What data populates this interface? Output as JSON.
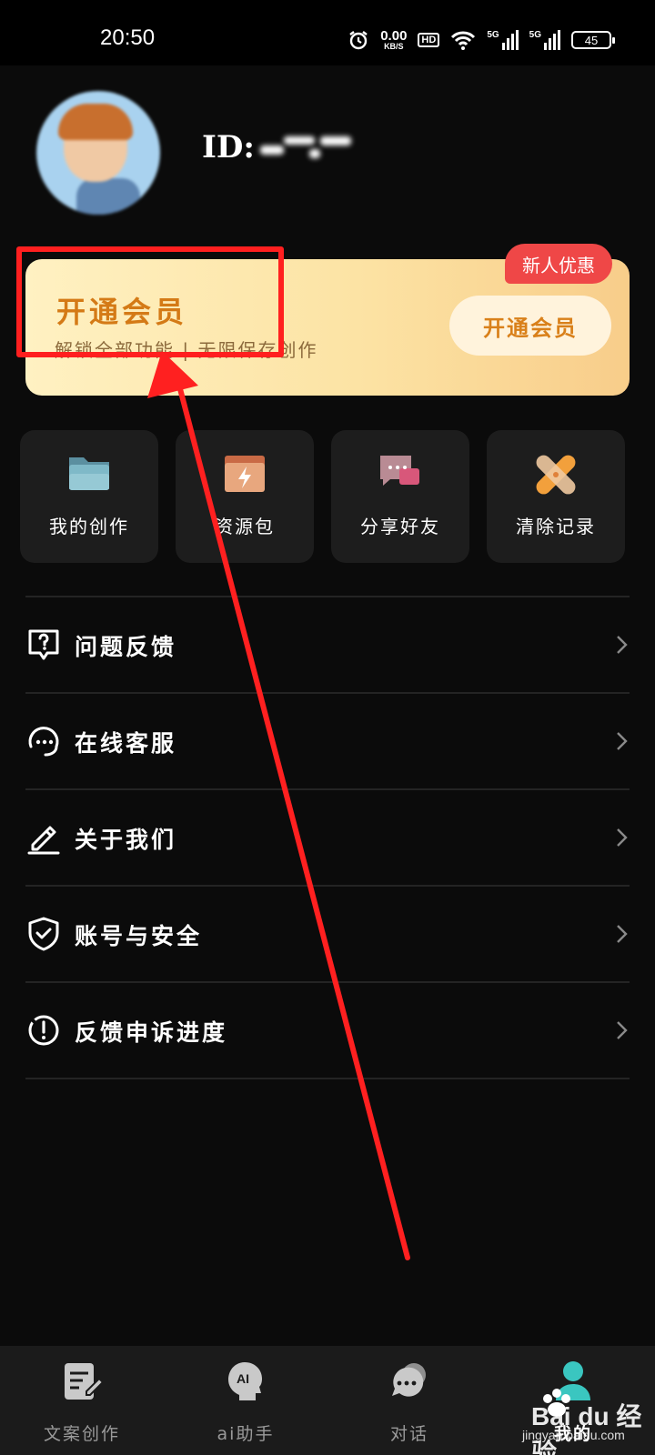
{
  "status_bar": {
    "time": "20:50",
    "net_speed_value": "0.00",
    "net_speed_unit": "KB/S",
    "hd_label": "HD",
    "signal_1_label": "5G",
    "signal_2_label": "5G",
    "battery": "45"
  },
  "profile": {
    "id_label": "ID:"
  },
  "vip_card": {
    "title": "开通会员",
    "subtitle": "解锁全部功能 | 无限保存创作",
    "button_label": "开通会员",
    "badge": "新人优惠"
  },
  "quick_grid": [
    {
      "label": "我的创作",
      "icon": "folder-icon"
    },
    {
      "label": "资源包",
      "icon": "lightning-box-icon"
    },
    {
      "label": "分享好友",
      "icon": "chat-bubble-icon"
    },
    {
      "label": "清除记录",
      "icon": "bandage-icon"
    }
  ],
  "menu": [
    {
      "label": "问题反馈",
      "icon": "question-feedback-icon"
    },
    {
      "label": "在线客服",
      "icon": "customer-service-icon"
    },
    {
      "label": "关于我们",
      "icon": "pencil-icon"
    },
    {
      "label": "账号与安全",
      "icon": "shield-check-icon"
    },
    {
      "label": "反馈申诉进度",
      "icon": "exclamation-circle-icon"
    }
  ],
  "bottom_nav": [
    {
      "label": "文案创作",
      "icon": "document-edit-icon",
      "active": false
    },
    {
      "label": "ai助手",
      "icon": "ai-head-icon",
      "active": false
    },
    {
      "label": "对话",
      "icon": "chat-icon",
      "active": false
    },
    {
      "label": "我的",
      "icon": "user-icon",
      "active": true
    }
  ],
  "watermark": {
    "brand": "Bai du 经验",
    "url": "jingyan.baidu.com"
  },
  "colors": {
    "background": "#0b0b0b",
    "vip_gold": "#d47a16",
    "badge_red": "#ef4747",
    "annotation_red": "#ff1f1f",
    "accent_teal": "#3ac6c0"
  }
}
